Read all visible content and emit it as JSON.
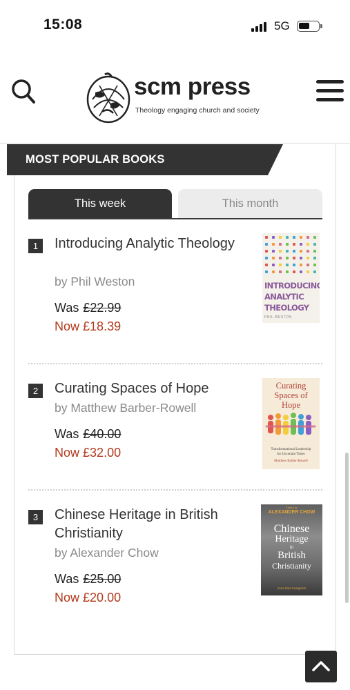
{
  "status_bar": {
    "time": "15:08",
    "network": "5G"
  },
  "header": {
    "logo_name": "scm press",
    "logo_tagline": "Theology engaging church and society",
    "search_icon": "search-icon",
    "menu_icon": "hamburger-menu-icon"
  },
  "section": {
    "title": "MOST POPULAR BOOKS",
    "tabs": [
      {
        "label": "This week",
        "active": true
      },
      {
        "label": "This month",
        "active": false
      }
    ]
  },
  "books": [
    {
      "rank": "1",
      "title": "Introducing Analytic Theology",
      "author": "by Phil Weston",
      "was_label": "Was",
      "was_price": "£22.99",
      "now_label": "Now",
      "now_price": "£18.39",
      "cover": {
        "title_line1": "INTRODUCING",
        "title_line2": "ANALYTIC",
        "title_line3": "THEOLOGY",
        "author": "PHIL WESTON"
      }
    },
    {
      "rank": "2",
      "title": "Curating Spaces of Hope",
      "author": "by Matthew Barber-Rowell",
      "was_label": "Was",
      "was_price": "£40.00",
      "now_label": "Now",
      "now_price": "£32.00",
      "cover": {
        "title_line1": "Curating",
        "title_line2": "Spaces of",
        "title_line3": "Hope",
        "subtitle_line1": "Transformational Leadership",
        "subtitle_line2": "for Uncertain Times",
        "author": "Matthew Barber-Rowell"
      }
    },
    {
      "rank": "3",
      "title": "Chinese Heritage in British Christianity",
      "author": "by Alexander Chow",
      "was_label": "Was",
      "was_price": "£25.00",
      "now_label": "Now",
      "now_price": "£20.00",
      "cover": {
        "editor_prefix": "Edited by",
        "author": "ALEXANDER CHOW",
        "title_line1": "Chinese",
        "title_line2": "Heritage",
        "title_line3": "in",
        "title_line4": "British",
        "title_line5": "Christianity",
        "subtitle": "more than foreigners"
      }
    }
  ],
  "back_to_top_icon": "chevron-up-icon",
  "colors": {
    "accent_price": "#b23a1c",
    "banner": "#333333",
    "tab_active": "#333333",
    "tab_inactive": "#ececec"
  }
}
